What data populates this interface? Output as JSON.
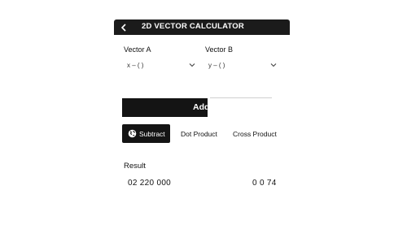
{
  "app": {
    "title": "2D VECTOR CALCULATOR",
    "back_icon": "chevron-left-icon"
  },
  "vector_a": {
    "label": "Vector A",
    "value": "x – (  )",
    "dropdown_icon": "chevron-down-icon"
  },
  "vector_b": {
    "label": "Vector B",
    "value": "y – (  )",
    "dropdown_icon": "chevron-down-icon"
  },
  "add_button": {
    "label": "Add"
  },
  "tabs": [
    {
      "label": "Subtract",
      "icon": "globe-icon",
      "active": true
    },
    {
      "label": "Dot Product",
      "active": false
    },
    {
      "label": "Cross Product",
      "active": false
    }
  ],
  "result": {
    "label": "Result",
    "left_value": "02 220 000",
    "right_value": "0 0 74"
  },
  "colors": {
    "dark": "#141414",
    "background": "#ffffff",
    "text": "#111111"
  }
}
